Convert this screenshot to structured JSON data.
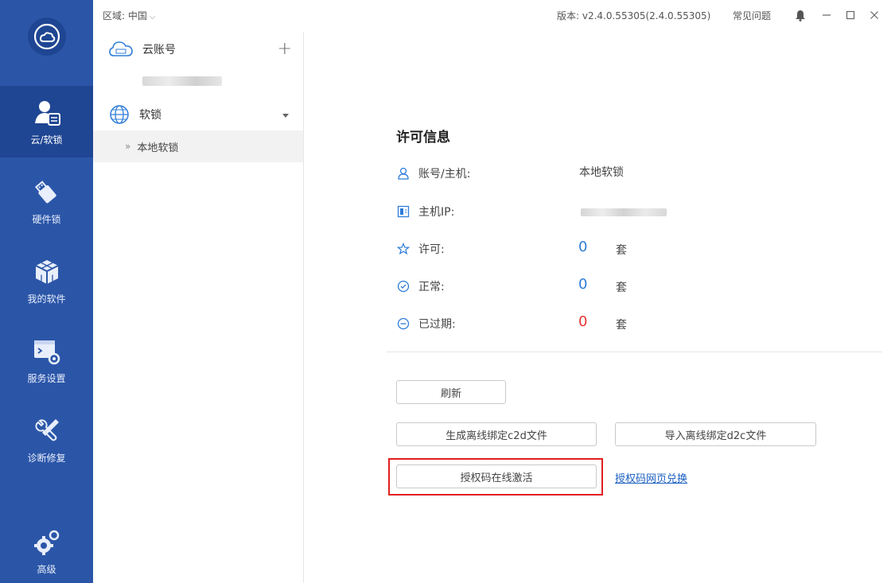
{
  "rail": {
    "items": [
      {
        "label": "云/软锁",
        "icon": "user-doc-icon",
        "active": true
      },
      {
        "label": "硬件锁",
        "icon": "usb-key-icon"
      },
      {
        "label": "我的软件",
        "icon": "cube-icon"
      },
      {
        "label": "服务设置",
        "icon": "terminal-gear-icon"
      },
      {
        "label": "诊断修复",
        "icon": "wrench-screwdriver-icon"
      },
      {
        "label": "高级",
        "icon": "gears-icon"
      }
    ]
  },
  "topbar": {
    "region": "区域: 中国",
    "version": "版本: v2.4.0.55305(2.4.0.55305)",
    "faq": "常见问题"
  },
  "sidebar": {
    "cloud_account": "云账号",
    "plus": "+",
    "soft_lock": "软锁",
    "local_soft_lock": "本地软锁",
    "sub_arrow": "»"
  },
  "main": {
    "title": "许可信息",
    "rows": [
      {
        "label": "账号/主机:",
        "value": "本地软锁"
      },
      {
        "label": "主机IP:"
      },
      {
        "label": "许可:",
        "count": "0",
        "unit": "套"
      },
      {
        "label": "正常:",
        "count": "0",
        "unit": "套"
      },
      {
        "label": "已过期:",
        "count": "0",
        "unit": "套"
      }
    ],
    "buttons": {
      "refresh": "刷新",
      "gen_c2d": "生成离线绑定c2d文件",
      "import_d2c": "导入离线绑定d2c文件",
      "activate": "授权码在线激活",
      "web_redeem": "授权码网页兑换"
    }
  },
  "colors": {
    "rail_bg": "#2b56a8",
    "accent_blue": "#2f7ed8",
    "expired_red": "#e63535",
    "highlight_red": "#e02020"
  }
}
